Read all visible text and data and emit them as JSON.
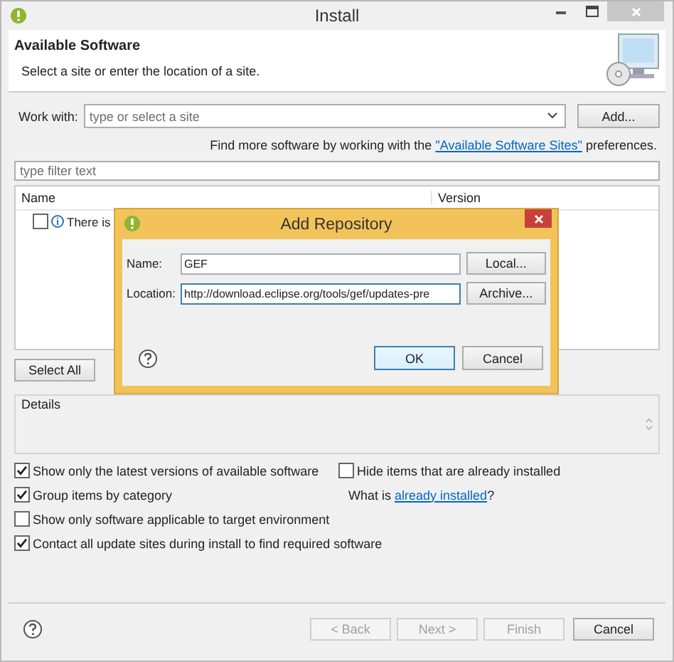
{
  "window": {
    "title": "Install"
  },
  "header": {
    "title": "Available Software",
    "subtitle": "Select a site or enter the location of a site."
  },
  "work_with": {
    "label": "Work with:",
    "placeholder": "type or select a site",
    "button": "Add..."
  },
  "hint": {
    "before": "Find more software by working with the",
    "link": "\"Available Software Sites\"",
    "after": "preferences."
  },
  "filter": {
    "placeholder": "type filter text"
  },
  "table": {
    "columns": [
      "Name",
      "Version"
    ],
    "rows": [
      {
        "checked": false,
        "text": "There is"
      }
    ]
  },
  "list_buttons": [
    "Select All"
  ],
  "details": {
    "label": "Details"
  },
  "left_options": [
    {
      "label": "Show only the latest versions of available software",
      "checked": true
    },
    {
      "label": "Group items by category",
      "checked": true
    },
    {
      "label": "Show only software applicable to target environment",
      "checked": false
    },
    {
      "label": "Contact all update sites during install to find required software",
      "checked": true
    }
  ],
  "right_options": [
    {
      "kind": "checkbox",
      "label": "Hide items that are already installed",
      "checked": false
    },
    {
      "kind": "link",
      "before": "What is",
      "link": "already installed",
      "after": "?"
    }
  ],
  "footer_buttons": [
    {
      "label": "< Back",
      "disabled": true
    },
    {
      "label": "Next >",
      "disabled": true
    },
    {
      "label": "Finish",
      "disabled": true
    },
    {
      "label": "Cancel",
      "disabled": false
    }
  ],
  "dialog": {
    "title": "Add Repository",
    "fields": [
      {
        "label": "Name:",
        "value": "GEF",
        "button": "Local..."
      },
      {
        "label": "Location:",
        "value": "http://download.eclipse.org/tools/gef/updates-pre",
        "button": "Archive..."
      }
    ],
    "buttons": [
      {
        "label": "OK",
        "default": true
      },
      {
        "label": "Cancel",
        "default": false
      }
    ]
  }
}
